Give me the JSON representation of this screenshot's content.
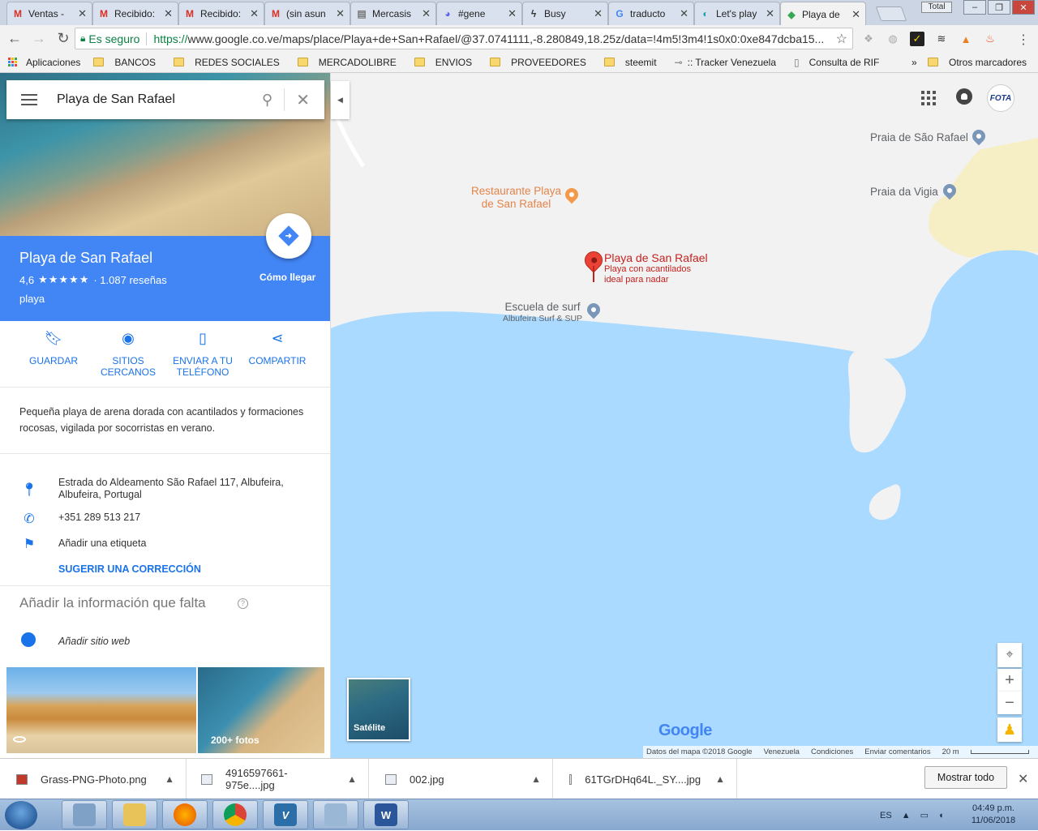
{
  "browser": {
    "tabs": [
      {
        "label": "Ventas -",
        "icon": "gmail-icon",
        "active": false
      },
      {
        "label": "Recibido:",
        "icon": "gmail-icon",
        "active": false
      },
      {
        "label": "Recibido:",
        "icon": "gmail-icon",
        "active": false
      },
      {
        "label": "(sin asun",
        "icon": "gmail-icon",
        "active": false
      },
      {
        "label": "Mercasis",
        "icon": "document-icon",
        "active": false
      },
      {
        "label": "#gene",
        "icon": "discord-icon",
        "active": false
      },
      {
        "label": "Busy",
        "icon": "lightning-icon",
        "active": false
      },
      {
        "label": "traducto",
        "icon": "google-icon",
        "active": false
      },
      {
        "label": "Let's play",
        "icon": "steemit-icon",
        "active": false
      },
      {
        "label": "Playa de",
        "icon": "maps-icon",
        "active": true
      }
    ],
    "total_label": "Total",
    "secure_label": "Es seguro",
    "url_scheme": "https://",
    "url_rest": "www.google.co.ve/maps/place/Playa+de+San+Rafael/@37.0741111,-8.280849,18.25z/data=!4m5!3m4!1s0x0:0xe847dcba15...",
    "bookmarks": [
      {
        "label": "Aplicaciones",
        "kind": "apps"
      },
      {
        "label": "BANCOS",
        "kind": "folder"
      },
      {
        "label": "REDES SOCIALES",
        "kind": "folder"
      },
      {
        "label": "MERCADOLIBRE",
        "kind": "folder"
      },
      {
        "label": "ENVIOS",
        "kind": "folder"
      },
      {
        "label": "PROVEEDORES",
        "kind": "folder"
      },
      {
        "label": "steemit",
        "kind": "folder"
      },
      {
        "label": ":: Tracker Venezuela",
        "kind": "link"
      },
      {
        "label": "Consulta de RIF",
        "kind": "page"
      }
    ],
    "more_bookmarks": "»",
    "other_bookmarks": "Otros marcadores"
  },
  "maps": {
    "search_value": "Playa de San Rafael",
    "place": {
      "name": "Playa de San Rafael",
      "rating": "4,6",
      "stars": "★★★★★",
      "reviews": "· 1.087 reseñas",
      "type": "playa",
      "directions_label": "Cómo llegar"
    },
    "actions": [
      {
        "label": "GUARDAR",
        "icon": "bookmark-icon"
      },
      {
        "label": "SITIOS CERCANOS",
        "icon": "nearby-icon"
      },
      {
        "label": "ENVIAR A TU TELÉFONO",
        "icon": "send-to-phone-icon"
      },
      {
        "label": "COMPARTIR",
        "icon": "share-icon"
      }
    ],
    "description": "Pequeña playa de arena dorada con acantilados y formaciones rocosas, vigilada por socorristas en verano.",
    "address": "Estrada do Aldeamento São Rafael 117, Albufeira, Albufeira, Portugal",
    "phone": "+351 289 513 217",
    "add_label": "Añadir una etiqueta",
    "suggest_edit": "SUGERIR UNA CORRECCIÓN",
    "missing_info_title": "Añadir la información que falta",
    "add_website": "Añadir sitio web",
    "photos_count": "200+ fotos",
    "map_labels": {
      "praia_sao_rafael": "Praia de São Rafael",
      "praia_vigia": "Praia da Vigia",
      "restaurante_line1": "Restaurante Playa",
      "restaurante_line2": "de San Rafael",
      "selected_name": "Playa de San Rafael",
      "selected_desc_line1": "Playa con acantilados",
      "selected_desc_line2": "ideal para nadar",
      "surf_line1": "Escuela de surf",
      "surf_line2": "Albufeira Surf & SUP"
    },
    "avatar_text": "FOTA",
    "satellite_label": "Satélite",
    "google_logo": "Google",
    "attribution": {
      "data": "Datos del mapa ©2018 Google",
      "region": "Venezuela",
      "terms": "Condiciones",
      "feedback": "Enviar comentarios",
      "scale": "20 m"
    },
    "colors": {
      "water": "#aadaff",
      "land": "#f2f2f2",
      "sand": "#f6eec4",
      "accent": "#4285f4",
      "pin": "#ea4335"
    }
  },
  "downloads": {
    "items": [
      {
        "name": "Grass-PNG-Photo.png"
      },
      {
        "name": "4916597661-975e....jpg"
      },
      {
        "name": "002.jpg"
      },
      {
        "name": "61TGrDHq64L._SY....jpg"
      }
    ],
    "show_all": "Mostrar todo"
  },
  "taskbar": {
    "language": "ES",
    "time": "04:49 p.m.",
    "date": "11/06/2018"
  }
}
